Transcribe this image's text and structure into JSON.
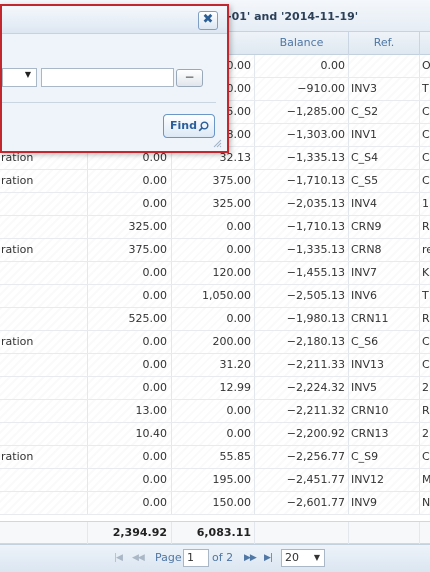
{
  "topbar": {
    "title_fragment": "-01' and '2014-11-19'"
  },
  "columns": {
    "balance": "Balance",
    "ref": "Ref."
  },
  "rows": [
    {
      "desc": "",
      "debit": "",
      "credit": "0.00",
      "balance": "0.00",
      "ref": "",
      "extra": "O"
    },
    {
      "desc": "",
      "debit": "",
      "credit": "0.00",
      "balance": "−910.00",
      "ref": "INV3",
      "extra": "T"
    },
    {
      "desc": "",
      "debit": "",
      "credit": "5.00",
      "balance": "−1,285.00",
      "ref": "C_S2",
      "extra": "C"
    },
    {
      "desc": "",
      "debit": "",
      "credit": "8.00",
      "balance": "−1,303.00",
      "ref": "INV1",
      "extra": "C"
    },
    {
      "desc": "ration",
      "debit": "0.00",
      "credit": "32.13",
      "balance": "−1,335.13",
      "ref": "C_S4",
      "extra": "C"
    },
    {
      "desc": "ration",
      "debit": "0.00",
      "credit": "375.00",
      "balance": "−1,710.13",
      "ref": "C_S5",
      "extra": "C"
    },
    {
      "desc": "",
      "debit": "0.00",
      "credit": "325.00",
      "balance": "−2,035.13",
      "ref": "INV4",
      "extra": "1"
    },
    {
      "desc": "",
      "debit": "325.00",
      "credit": "0.00",
      "balance": "−1,710.13",
      "ref": "CRN9",
      "extra": "R"
    },
    {
      "desc": "ration",
      "debit": "375.00",
      "credit": "0.00",
      "balance": "−1,335.13",
      "ref": "CRN8",
      "extra": "re"
    },
    {
      "desc": "",
      "debit": "0.00",
      "credit": "120.00",
      "balance": "−1,455.13",
      "ref": "INV7",
      "extra": "K"
    },
    {
      "desc": "",
      "debit": "0.00",
      "credit": "1,050.00",
      "balance": "−2,505.13",
      "ref": "INV6",
      "extra": "T"
    },
    {
      "desc": "",
      "debit": "525.00",
      "credit": "0.00",
      "balance": "−1,980.13",
      "ref": "CRN11",
      "extra": "R"
    },
    {
      "desc": "ration",
      "debit": "0.00",
      "credit": "200.00",
      "balance": "−2,180.13",
      "ref": "C_S6",
      "extra": "C"
    },
    {
      "desc": "",
      "debit": "0.00",
      "credit": "31.20",
      "balance": "−2,211.33",
      "ref": "INV13",
      "extra": "C"
    },
    {
      "desc": "",
      "debit": "0.00",
      "credit": "12.99",
      "balance": "−2,224.32",
      "ref": "INV5",
      "extra": "2"
    },
    {
      "desc": "",
      "debit": "13.00",
      "credit": "0.00",
      "balance": "−2,211.32",
      "ref": "CRN10",
      "extra": "R"
    },
    {
      "desc": "",
      "debit": "10.40",
      "credit": "0.00",
      "balance": "−2,200.92",
      "ref": "CRN13",
      "extra": "2"
    },
    {
      "desc": "ration",
      "debit": "0.00",
      "credit": "55.85",
      "balance": "−2,256.77",
      "ref": "C_S9",
      "extra": "C"
    },
    {
      "desc": "",
      "debit": "0.00",
      "credit": "195.00",
      "balance": "−2,451.77",
      "ref": "INV12",
      "extra": "M"
    },
    {
      "desc": "",
      "debit": "0.00",
      "credit": "150.00",
      "balance": "−2,601.77",
      "ref": "INV9",
      "extra": "N"
    }
  ],
  "summary": {
    "debit_total": "2,394.92",
    "credit_total": "6,083.11"
  },
  "pager": {
    "first_icon": "first-page-icon",
    "prev_icon": "previous-page-icon",
    "next_icon": "next-page-icon",
    "last_icon": "last-page-icon",
    "page_label": "Page",
    "current_page": "1",
    "of_label": "of 2",
    "page_size": "20"
  },
  "dialog": {
    "close_label": "✖",
    "minus_label": "−",
    "find_label": "Find",
    "find_icon": "search-icon",
    "close_icon": "close-icon"
  },
  "colors": {
    "dialog_border": "#c1272d",
    "header_text": "#4f77a5",
    "find_text": "#2a5f9c"
  }
}
